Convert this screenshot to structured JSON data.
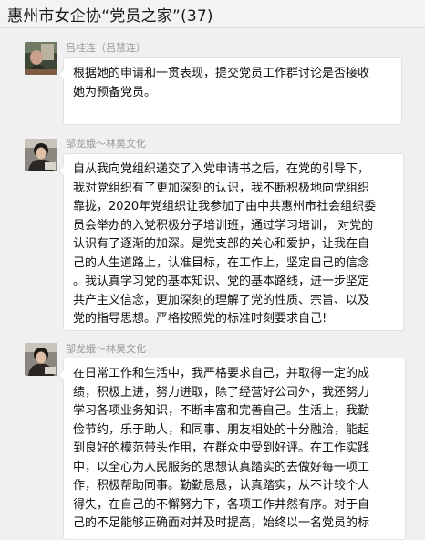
{
  "header": {
    "title": "惠州市女企协“党员之家”(37)"
  },
  "messages": [
    {
      "sender": "吕桂连（吕慧连）",
      "lines": [
        "根据她的申请和一贯表现，提交党员工作群讨论是否接收",
        "她为预备党员。"
      ]
    },
    {
      "sender": "邹龙娥～林昊文化",
      "lines": [
        "自从我向党组织递交了入党申请书之后，在党的引导下，",
        "我对党组织有了更加深刻的认识，我不断积极地向党组织",
        "靠拢，2020年党组织让我参加了由中共惠州市社会组织委",
        "员会举办的入党积极分子培训班，通过学习培训， 对党的",
        "认识有了逐渐的加深。是党支部的关心和爱护，让我在自",
        "己的人生道路上，认准目标，在工作上，坚定自己的信念",
        "。我认真学习党的基本知识、党的基本路线，进一步坚定",
        "共产主义信念，更加深刻的理解了党的性质、宗旨、以及",
        "党的指导思想。严格按照党的标准时刻要求自己!"
      ]
    },
    {
      "sender": "邹龙娥～林昊文化",
      "lines": [
        "在日常工作和生活中，我严格要求自己，并取得一定的成",
        "绩，积极上进，努力进取，除了经营好公司外，我还努力",
        "学习各项业务知识，不断丰富和完善自己。生活上，我勤",
        "俭节约，乐于助人，和同事、朋友相处的十分融洽，能起",
        "到良好的模范带头作用，在群众中受到好评。在工作实践",
        "中，以全心为人民服务的思想认真踏实的去做好每一项工",
        "作，积极帮助同事。勤勤恳恳，认真踏实，从不计较个人",
        "得失，在自己的不懈努力下，各项工作井然有序。对于自",
        "己的不足能够正确面对并及时提高，始终以一名党员的标"
      ]
    }
  ]
}
